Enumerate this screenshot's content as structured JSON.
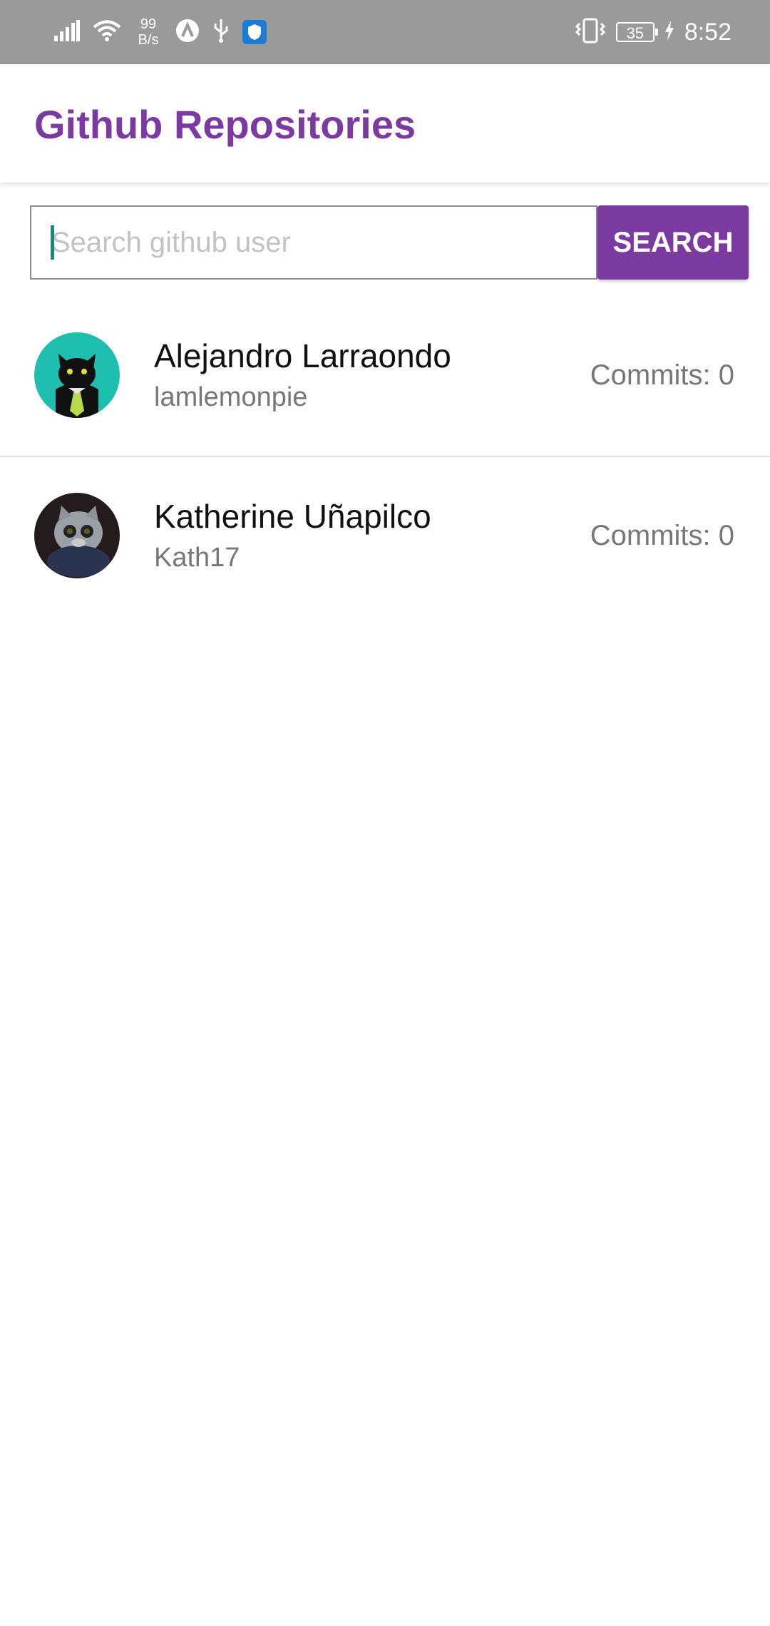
{
  "status_bar": {
    "net_speed_value": "99",
    "net_speed_unit": "B/s",
    "battery": "35",
    "time": "8:52",
    "icons": [
      "signal-icon",
      "wifi-icon",
      "app-a-icon",
      "usb-icon",
      "shield-icon",
      "vibrate-icon",
      "battery-icon",
      "charging-icon"
    ]
  },
  "app_bar": {
    "title": "Github Repositories"
  },
  "search": {
    "placeholder": "Search github user",
    "value": "",
    "button_label": "SEARCH"
  },
  "users": [
    {
      "name": "Alejandro Larraondo",
      "login": "lamlemonpie",
      "commits": "Commits: 0"
    },
    {
      "name": "Katherine Uñapilco",
      "login": "Kath17",
      "commits": "Commits: 0"
    }
  ],
  "colors": {
    "accent": "#7b3aa0",
    "status_bar": "#9a9a9a",
    "caret": "#0f8f7a"
  }
}
